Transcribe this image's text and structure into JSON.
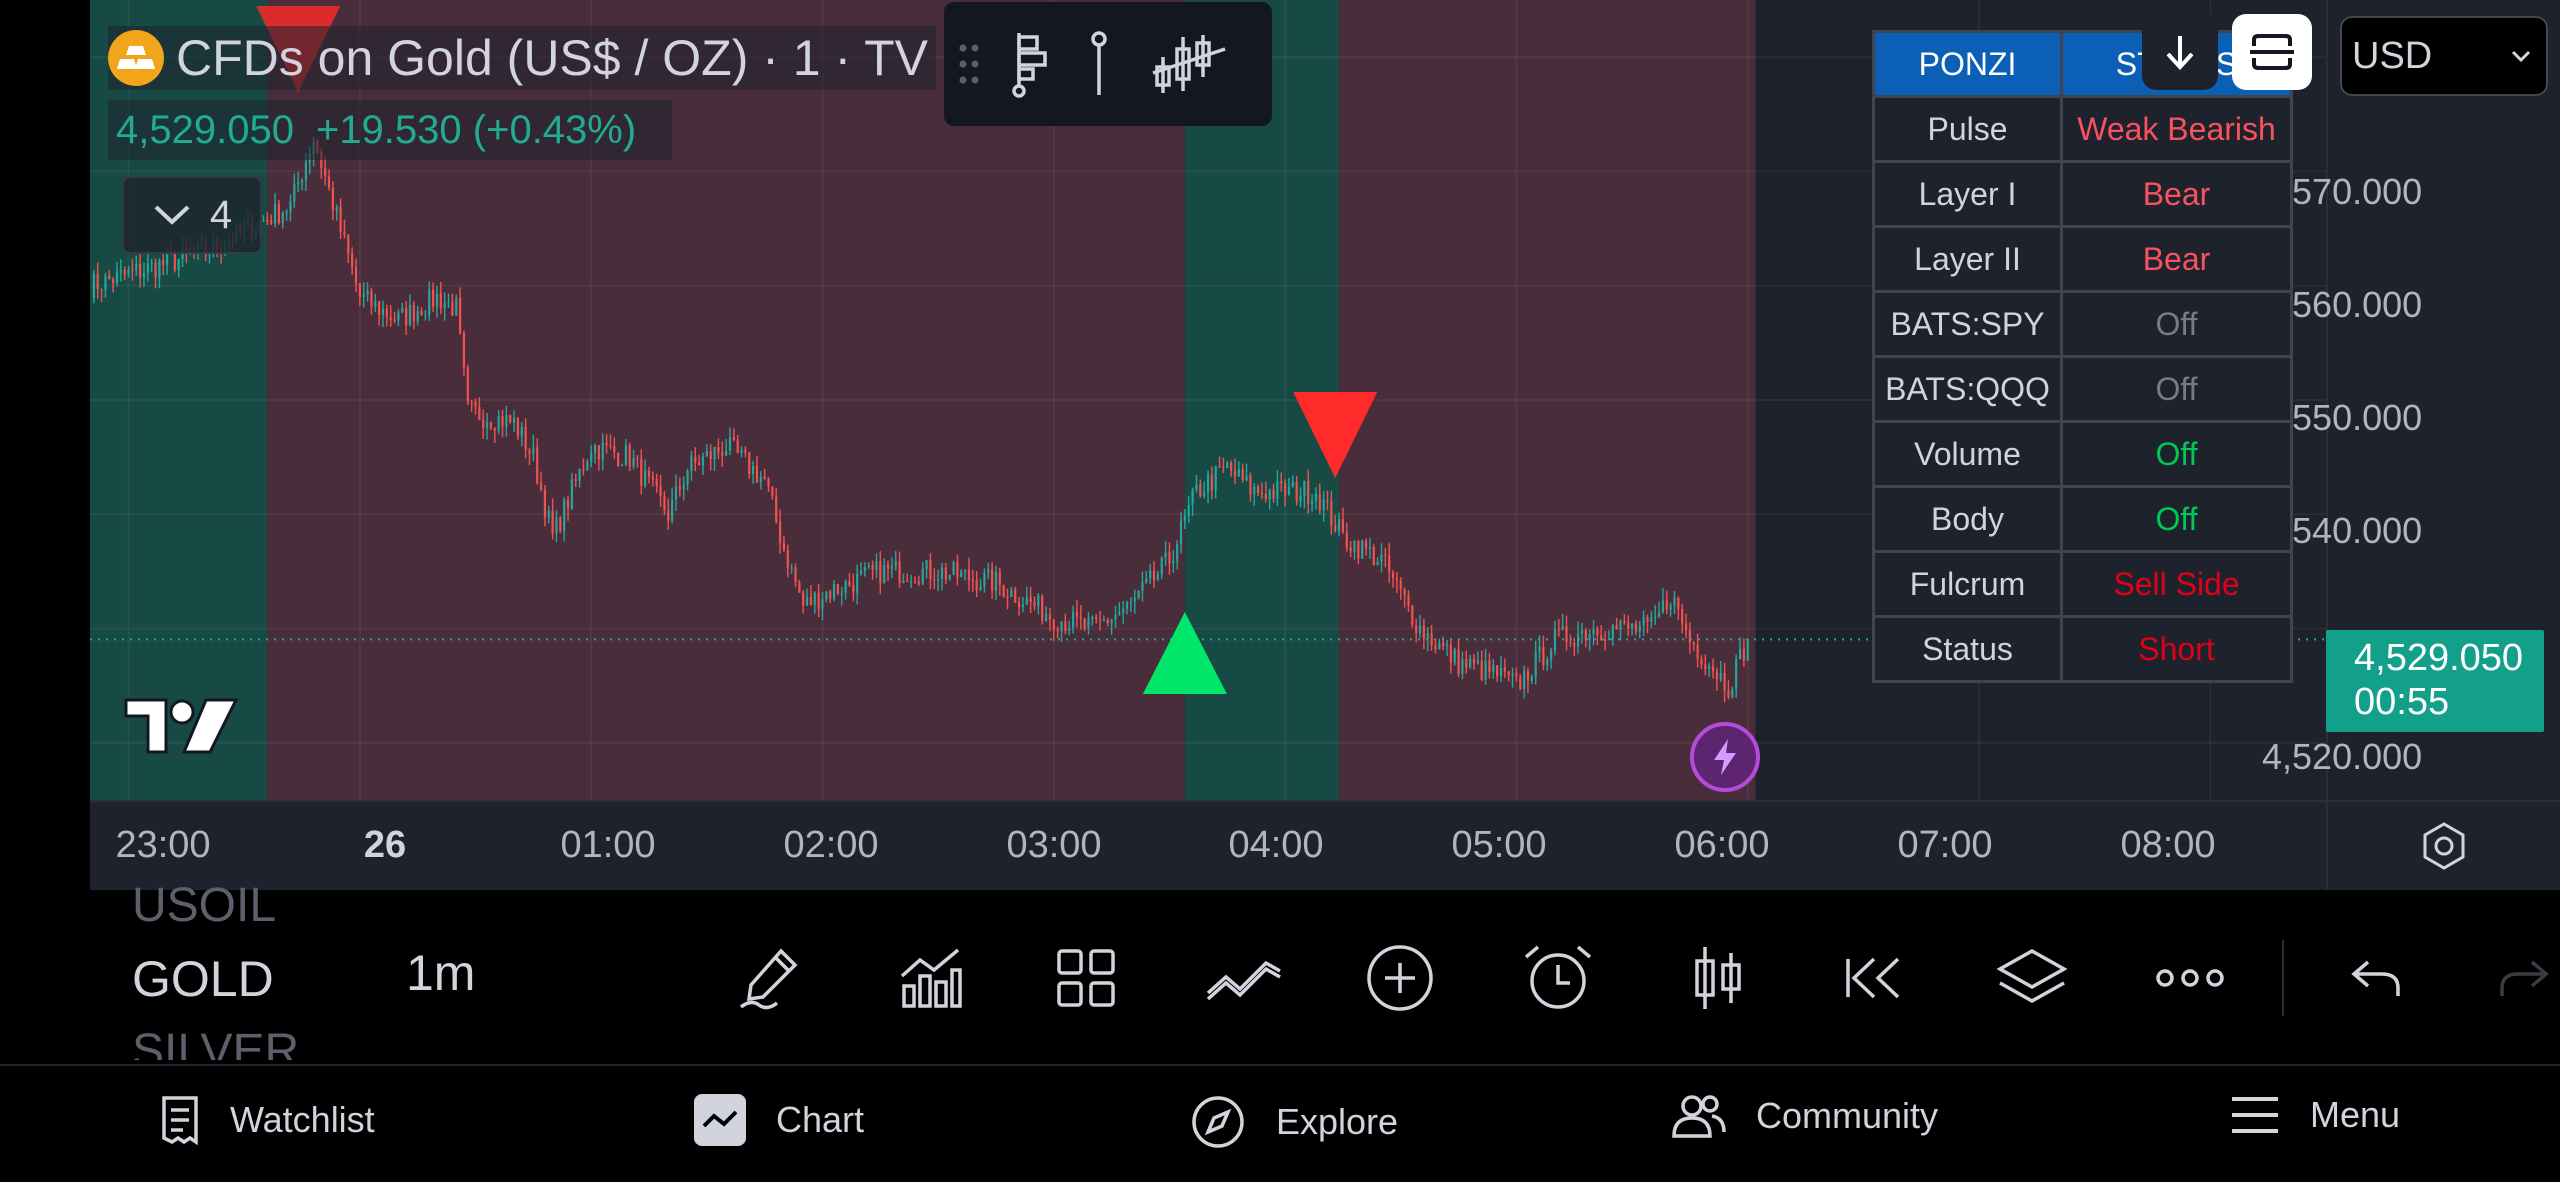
{
  "legend": {
    "title": "CFDs on Gold (US$ / OZ) · 1 · TV",
    "price": "4,529.050",
    "change": "+19.530 (+0.43%)",
    "collapsed_count": "4"
  },
  "price_axis": {
    "labels": [
      "4,570.000",
      "4,560.000",
      "4,550.000",
      "4,540.000",
      "4,520.000"
    ],
    "current_price": "4,529.050",
    "countdown": "00:55",
    "currency": "USD"
  },
  "time_axis": {
    "labels": [
      "23:00",
      "26",
      "01:00",
      "02:00",
      "03:00",
      "04:00",
      "05:00",
      "06:00",
      "07:00",
      "08:00"
    ]
  },
  "indicator_table": {
    "header": [
      "PONZI",
      "STATUS"
    ],
    "rows": [
      {
        "label": "Pulse",
        "value": "Weak Bearish",
        "color": "#f7525f"
      },
      {
        "label": "Layer I",
        "value": "Bear",
        "color": "#f7525f"
      },
      {
        "label": "Layer II",
        "value": "Bear",
        "color": "#f7525f"
      },
      {
        "label": "BATS:SPY",
        "value": "Off",
        "color": "#787b86"
      },
      {
        "label": "BATS:QQQ",
        "value": "Off",
        "color": "#787b86"
      },
      {
        "label": "Volume",
        "value": "Off",
        "color": "#00c853"
      },
      {
        "label": "Body",
        "value": "Off",
        "color": "#00c853"
      },
      {
        "label": "Fulcrum",
        "value": "Sell Side",
        "color": "#e0001a"
      },
      {
        "label": "Status",
        "value": "Short",
        "color": "#e0001a"
      }
    ]
  },
  "chart_data": {
    "type": "candlestick",
    "symbol": "GOLD",
    "interval": "1m",
    "ylim": [
      4515,
      4585
    ],
    "xlim": [
      "22:50",
      "08:30"
    ],
    "price_path": [
      [
        "22:50",
        4560
      ],
      [
        "23:20",
        4563
      ],
      [
        "23:42",
        4567
      ],
      [
        "23:48",
        4573
      ],
      [
        "00:00",
        4559
      ],
      [
        "00:10",
        4557
      ],
      [
        "00:20",
        4559
      ],
      [
        "00:25",
        4558
      ],
      [
        "00:28",
        4549
      ],
      [
        "00:40",
        4548
      ],
      [
        "00:45",
        4545
      ],
      [
        "00:50",
        4538
      ],
      [
        "01:00",
        4546
      ],
      [
        "01:10",
        4545
      ],
      [
        "01:20",
        4540
      ],
      [
        "01:25",
        4544
      ],
      [
        "01:35",
        4546
      ],
      [
        "01:45",
        4543
      ],
      [
        "01:50",
        4537
      ],
      [
        "01:55",
        4532
      ],
      [
        "02:00",
        4533
      ],
      [
        "02:15",
        4535
      ],
      [
        "02:30",
        4535
      ],
      [
        "02:45",
        4534
      ],
      [
        "03:00",
        4531
      ],
      [
        "03:10",
        4530
      ],
      [
        "03:20",
        4532
      ],
      [
        "03:30",
        4536
      ],
      [
        "03:37",
        4542
      ],
      [
        "03:45",
        4544
      ],
      [
        "03:52",
        4542
      ],
      [
        "04:00",
        4542
      ],
      [
        "04:08",
        4542
      ],
      [
        "04:15",
        4538
      ],
      [
        "04:25",
        4536
      ],
      [
        "04:35",
        4530
      ],
      [
        "04:45",
        4527
      ],
      [
        "04:55",
        4526
      ],
      [
        "05:00",
        4525
      ],
      [
        "05:10",
        4529
      ],
      [
        "05:20",
        4530
      ],
      [
        "05:35",
        4530
      ],
      [
        "05:40",
        4533
      ],
      [
        "05:45",
        4529
      ],
      [
        "05:55",
        4525
      ],
      [
        "06:00",
        4529
      ]
    ],
    "background_regions": [
      {
        "from": "22:50",
        "to": "23:36",
        "color": "teal"
      },
      {
        "from": "23:36",
        "to": "03:34",
        "color": "maroon"
      },
      {
        "from": "03:34",
        "to": "04:14",
        "color": "teal"
      },
      {
        "from": "04:14",
        "to": "06:02",
        "color": "maroon"
      }
    ],
    "signals": [
      {
        "type": "sell",
        "time": "23:44"
      },
      {
        "type": "buy",
        "time": "03:34"
      },
      {
        "type": "sell",
        "time": "04:13"
      }
    ],
    "last_price": 4529.05
  },
  "toolbar": {
    "symbols": [
      "USOIL",
      "GOLD",
      "SILVER"
    ],
    "active_symbol": "GOLD",
    "interval": "1m",
    "tools": [
      "pencil-icon",
      "indicators-icon",
      "layout-grid-icon",
      "trend-lines-icon",
      "add-icon",
      "alarm-icon",
      "candles-icon",
      "replay-icon",
      "layers-icon",
      "more-icon",
      "undo-icon",
      "redo-icon"
    ]
  },
  "nav": {
    "items": [
      "Watchlist",
      "Chart",
      "Explore",
      "Community",
      "Menu"
    ]
  }
}
